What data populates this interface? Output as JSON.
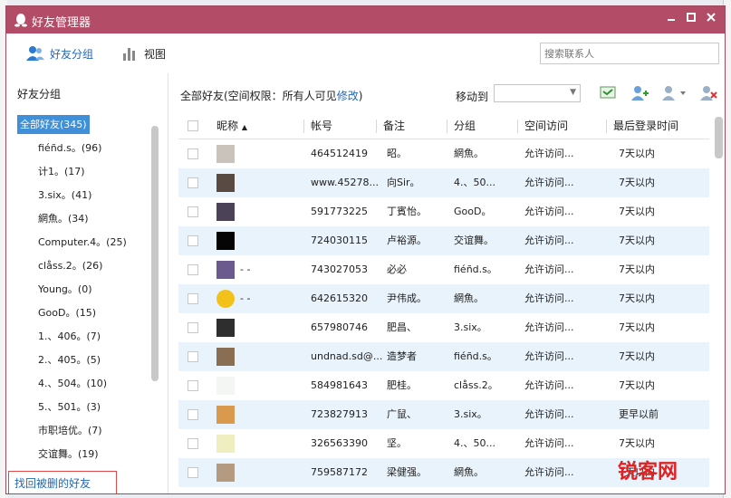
{
  "window": {
    "title": "好友管理器",
    "accent": "#b34d67"
  },
  "toolbar": {
    "tab_groups": "好友分组",
    "tab_view": "视图",
    "search_placeholder": "搜索联系人"
  },
  "sidebar": {
    "title": "好友分组",
    "groups": [
      "全部好友(345)",
      "fiéñd.s。(96)",
      "计1。(17)",
      "3.six。(41)",
      "網魚。(34)",
      "Computer.4。(25)",
      "clåss.2。(26)",
      "Young。(0)",
      "GooD。(15)",
      "1.、406。(7)",
      "2.、405。(5)",
      "4.、504。(10)",
      "5.、501。(3)",
      "市职培优。(7)",
      "交谊舞。(19)"
    ],
    "restore_link": "找回被删的好友"
  },
  "main": {
    "permission_prefix": "全部好友(空间权限：所有人可见",
    "permission_edit": "修改",
    "permission_suffix": ")",
    "move_to_label": "移动到",
    "move_to_value": "",
    "columns": {
      "nickname": "昵称",
      "sort_arrow": "▲",
      "account": "帐号",
      "remark": "备注",
      "group": "分组",
      "space": "空间访问",
      "last_login": "最后登录时间"
    },
    "rows": [
      {
        "nick": "",
        "account": "464512419",
        "remark": "昭。",
        "group": "網魚。",
        "space": "允许访问...",
        "login": "7天以内",
        "avatar": "#c9c3bb"
      },
      {
        "nick": "",
        "account": "www.45278...",
        "remark": "向Sir。",
        "group": "4.、50...",
        "space": "允许访问...",
        "login": "7天以内",
        "avatar": "#5a4a44"
      },
      {
        "nick": "",
        "account": "591773225",
        "remark": "丁賓怡。",
        "group": "GooD。",
        "space": "允许访问...",
        "login": "7天以内",
        "avatar": "#4b4258"
      },
      {
        "nick": "",
        "account": "724030115",
        "remark": "卢裕源。",
        "group": "交谊舞。",
        "space": "允许访问...",
        "login": "7天以内",
        "avatar": "#050505"
      },
      {
        "nick": "- -",
        "account": "743027053",
        "remark": "必必",
        "group": "fiéñd.s。",
        "space": "允许访问...",
        "login": "7天以内",
        "avatar": "#6b5a8e"
      },
      {
        "nick": "- -",
        "account": "642615320",
        "remark": "尹伟成。",
        "group": "網魚。",
        "space": "允许访问...",
        "login": "7天以内",
        "avatar": "#f2c21b"
      },
      {
        "nick": "",
        "account": "657980746",
        "remark": "肥昌、",
        "group": "3.six。",
        "space": "允许访问...",
        "login": "7天以内",
        "avatar": "#2e2e2e"
      },
      {
        "nick": "",
        "account": "undnad.sd@...",
        "remark": "造梦者",
        "group": "fiéñd.s。",
        "space": "允许访问...",
        "login": "7天以内",
        "avatar": "#8a6e54"
      },
      {
        "nick": "",
        "account": "584981643",
        "remark": "肥桂。",
        "group": "clåss.2。",
        "space": "允许访问...",
        "login": "7天以内",
        "avatar": "#f3f6f3"
      },
      {
        "nick": "",
        "account": "723827913",
        "remark": "广鼠、",
        "group": "3.six。",
        "space": "允许访问...",
        "login": "更早以前",
        "avatar": "#d99a4e"
      },
      {
        "nick": "",
        "account": "326563390",
        "remark": "坚。",
        "group": "4.、50...",
        "space": "允许访问...",
        "login": "7天以内",
        "avatar": "#eeeec0"
      },
      {
        "nick": "",
        "account": "759587172",
        "remark": "梁健强。",
        "group": "網魚。",
        "space": "允许访问...",
        "login": "7天以内",
        "avatar": "#b49a80"
      }
    ]
  },
  "watermark": {
    "text": "锐客网"
  }
}
